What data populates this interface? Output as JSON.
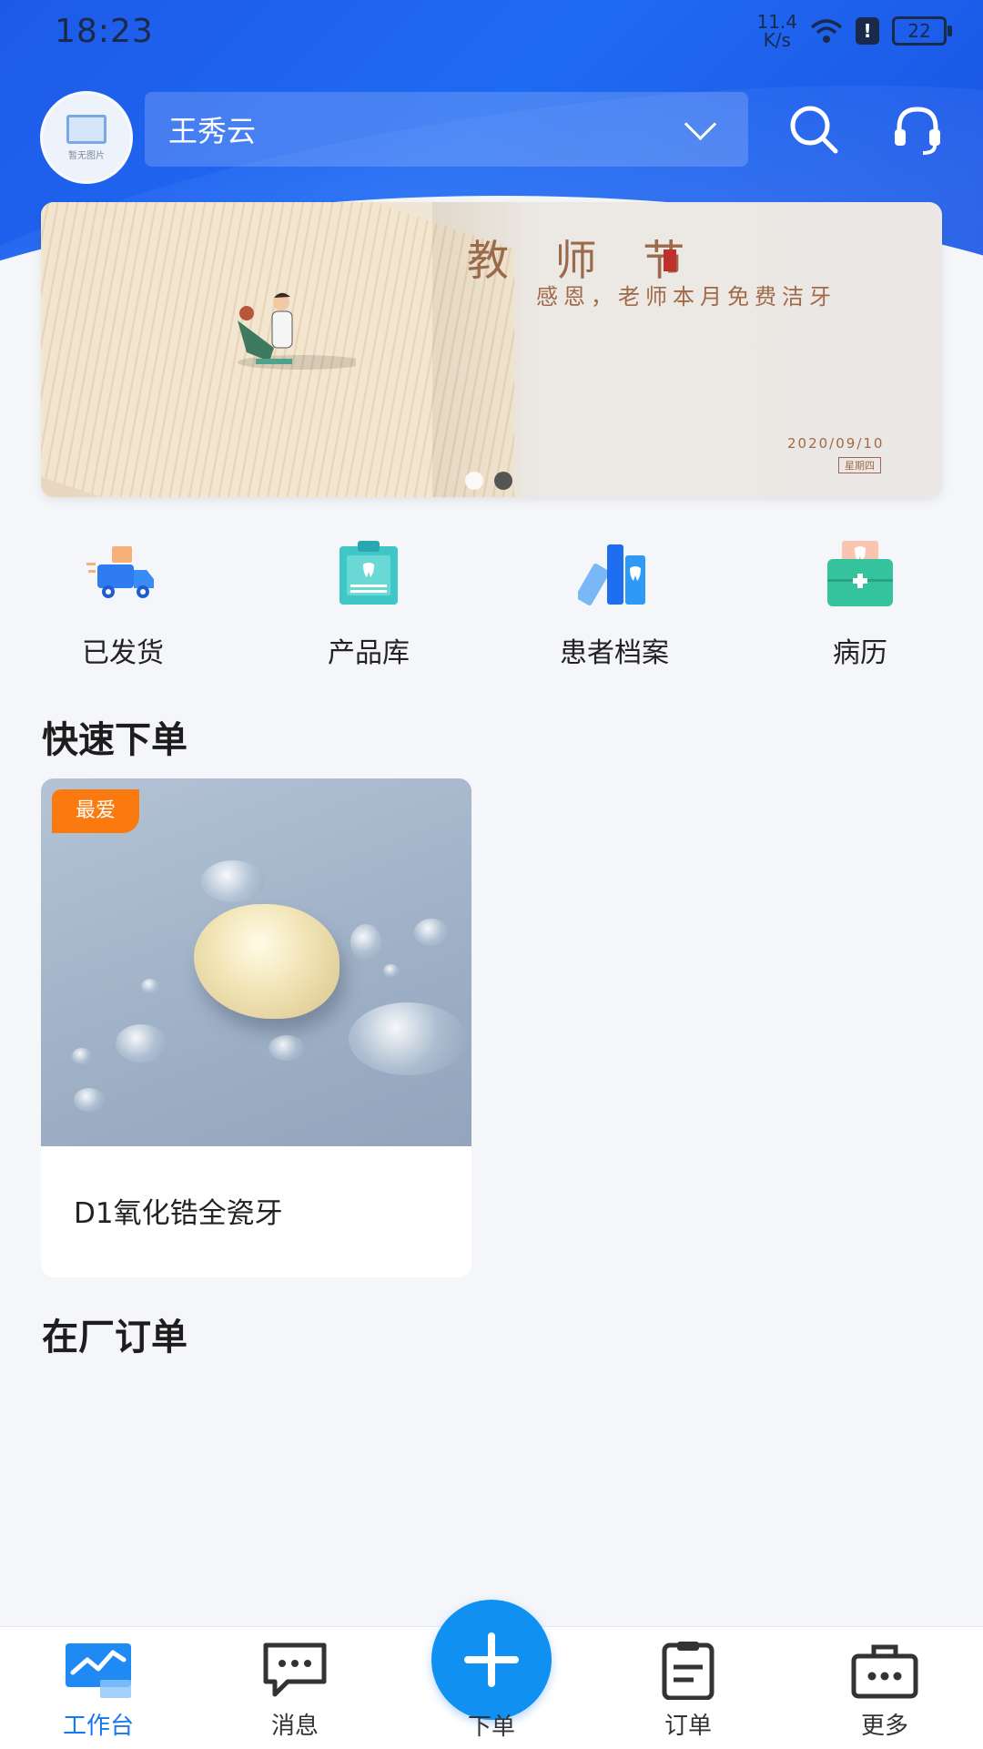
{
  "status_bar": {
    "time": "18:23",
    "net_speed_value": "11.4",
    "net_speed_unit": "K/s",
    "battery": "22"
  },
  "header": {
    "avatar_caption": "暂无图片",
    "selected_user": "王秀云",
    "search_icon": "search-icon",
    "support_icon": "headset-icon"
  },
  "banner": {
    "title": "教 师 节",
    "subtitle": "感恩，老师本月免费洁牙",
    "date": "2020/09/10",
    "weekday": "星期四",
    "page_count": 2,
    "active_page": 2
  },
  "quick_actions": [
    {
      "label": "已发货",
      "icon": "delivery-truck-icon"
    },
    {
      "label": "产品库",
      "icon": "clipboard-icon"
    },
    {
      "label": "患者档案",
      "icon": "archive-books-icon"
    },
    {
      "label": "病历",
      "icon": "medical-kit-icon"
    }
  ],
  "sections": {
    "quick_order": "快速下单",
    "factory_orders": "在厂订单"
  },
  "products": [
    {
      "name": "D1氧化锆全瓷牙",
      "badge": "最爱"
    }
  ],
  "tabbar": {
    "items": [
      {
        "label": "工作台",
        "icon": "workbench-chart-icon",
        "active": true
      },
      {
        "label": "消息",
        "icon": "message-bubble-icon",
        "active": false
      },
      {
        "label": "下单",
        "icon": "plus-icon",
        "active": false
      },
      {
        "label": "订单",
        "icon": "order-clipboard-icon",
        "active": false
      },
      {
        "label": "更多",
        "icon": "toolbox-icon",
        "active": false
      }
    ]
  },
  "colors": {
    "brand_blue": "#1e5ae8",
    "accent_blue": "#1677f2",
    "badge_orange": "#fb7a0f",
    "background": "#f4f6fa"
  }
}
